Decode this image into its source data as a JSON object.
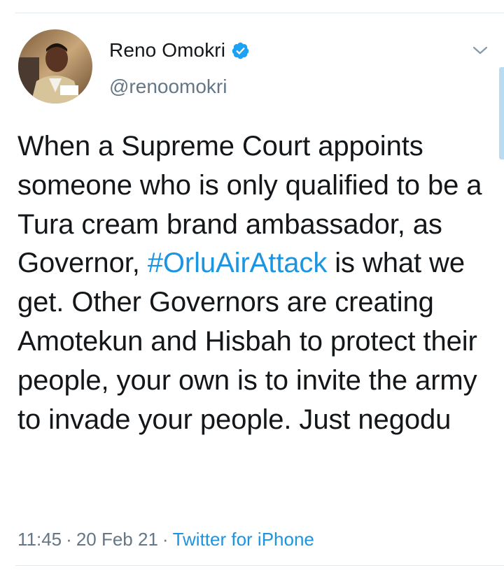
{
  "tweet": {
    "author": {
      "display_name": "Reno Omokri",
      "handle": "@renoomokri",
      "verified": true
    },
    "text_before_hashtag": "When a Supreme Court appoints someone who is only qualified to be a Tura cream brand ambassador, as Governor, ",
    "hashtag": "#OrluAirAttack",
    "text_after_hashtag": " is what we get. Other Governors are creating Amotekun and Hisbah to protect their people, your own is to invite the army to invade your people. Just negodu",
    "time": "11:45",
    "date": "20 Feb 21",
    "separator": "·",
    "source": "Twitter for iPhone"
  },
  "colors": {
    "text": "#14171a",
    "secondary": "#657786",
    "link": "#1b95e0",
    "verified": "#1da1f2",
    "divider": "#e1e8ed"
  },
  "icons": {
    "verified": "verified-badge-icon",
    "menu": "chevron-down-icon"
  }
}
